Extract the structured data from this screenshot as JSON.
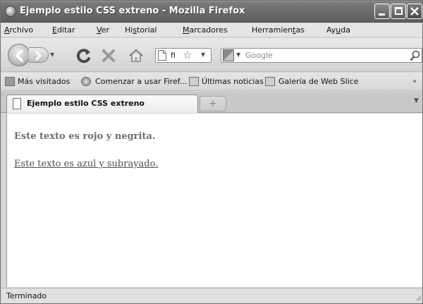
{
  "window": {
    "title": "Ejemplo estilo CSS extreno - Mozilla Firefox"
  },
  "menu": [
    {
      "pre": "",
      "key": "A",
      "post": "rchivo"
    },
    {
      "pre": "",
      "key": "E",
      "post": "ditar"
    },
    {
      "pre": "",
      "key": "V",
      "post": "er"
    },
    {
      "pre": "Hi",
      "key": "s",
      "post": "torial"
    },
    {
      "pre": "",
      "key": "M",
      "post": "arcadores"
    },
    {
      "pre": "Herramien",
      "key": "t",
      "post": "as"
    },
    {
      "pre": "Ay",
      "key": "u",
      "post": "da"
    }
  ],
  "navbar": {
    "url_value": "fi",
    "search_placeholder": "Google"
  },
  "bookmarks": {
    "items": [
      "Más visitados",
      "Comenzar a usar Firef...",
      "Últimas noticias",
      "Galería de Web Slice"
    ],
    "overflow": "»"
  },
  "tabs": {
    "active_label": "Ejemplo estilo CSS extreno",
    "new_tab": "+"
  },
  "content": {
    "paragraph1": "Este texto es rojo y negrita.",
    "paragraph2": "Este texto es azul y subrayado."
  },
  "status": {
    "text": "Terminado"
  }
}
